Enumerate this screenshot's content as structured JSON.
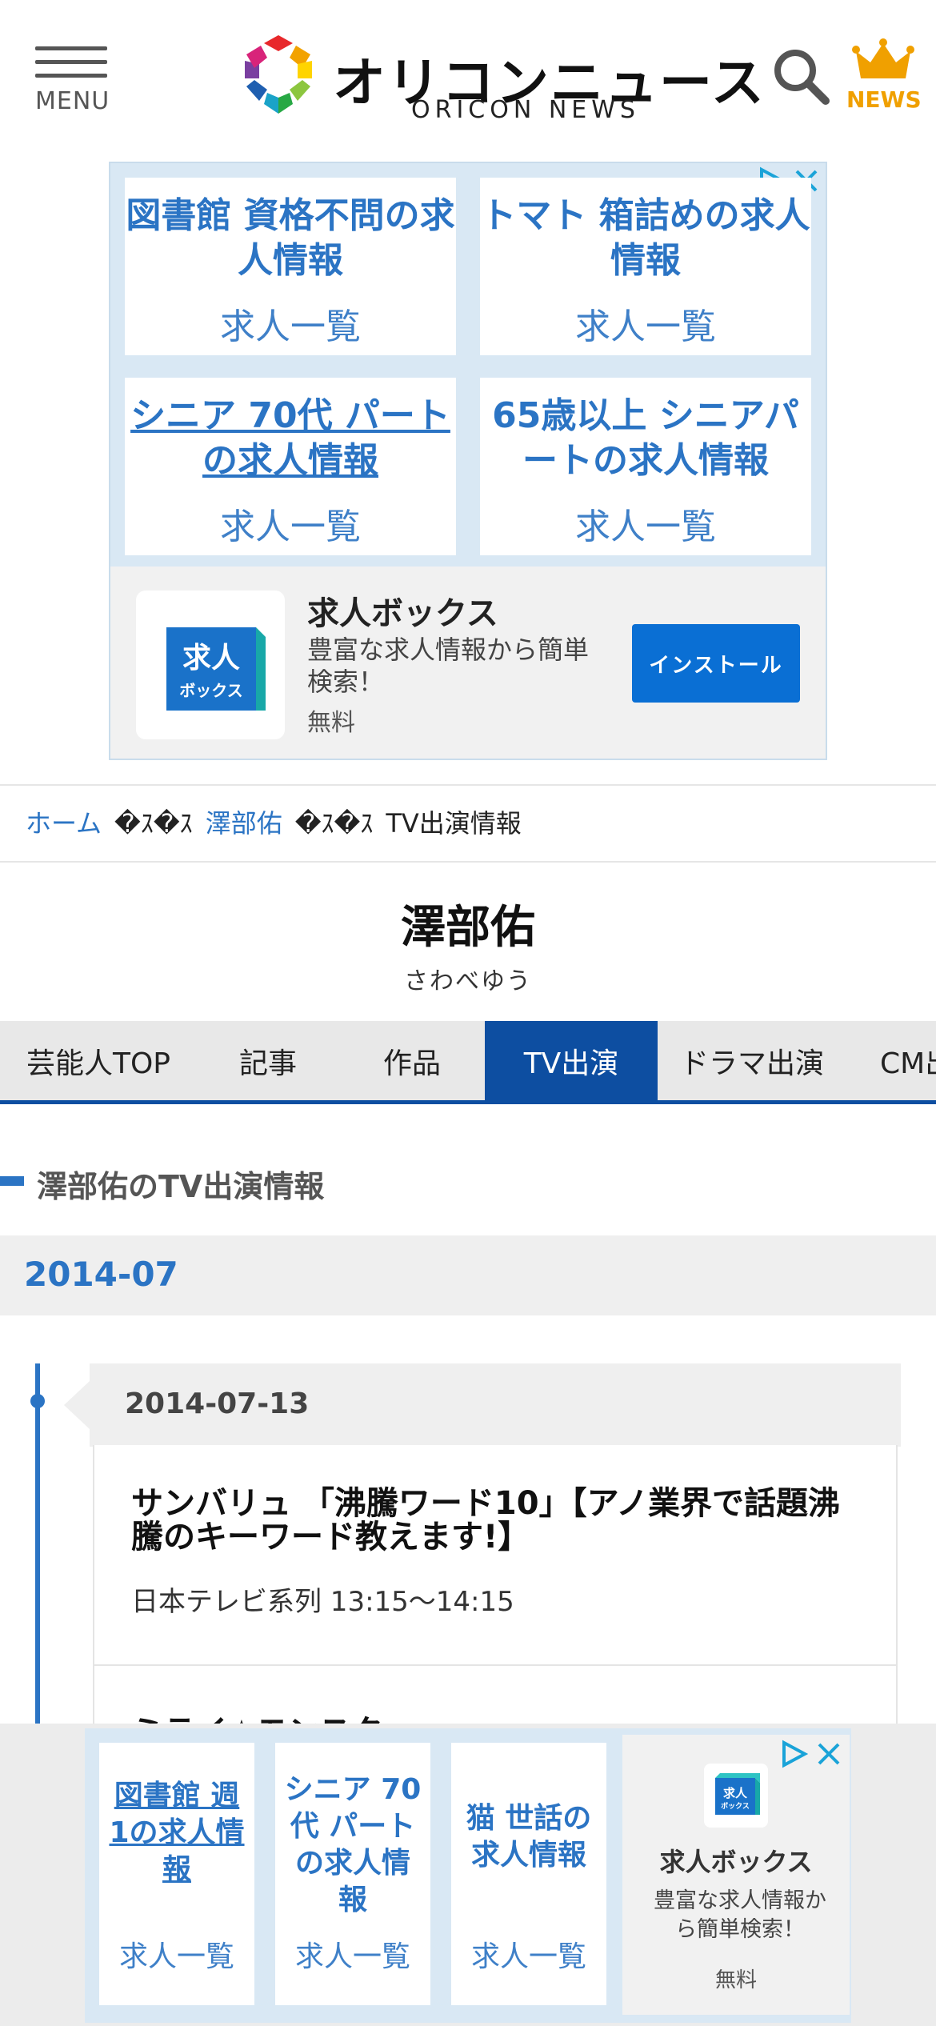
{
  "header": {
    "menu_label": "MENU",
    "logo_jp": "オリコンニュース",
    "logo_en": "ORICON NEWS",
    "news_label": "NEWS"
  },
  "ad_top": {
    "cells": [
      {
        "title": "図書館 資格不問の求人情報",
        "link": "求人一覧"
      },
      {
        "title": "トマト 箱詰めの求人情報",
        "link": "求人一覧"
      },
      {
        "title": "シニア 70代 パートの求人情報",
        "link": "求人一覧"
      },
      {
        "title": "65歳以上 シニアパートの求人情報",
        "link": "求人一覧"
      }
    ],
    "app": {
      "name": "求人ボックス",
      "description": "豊富な求人情報から簡単検索！",
      "price": "無料",
      "install_label": "インストール",
      "icon_text_1": "求人",
      "icon_text_2": "ボックス"
    }
  },
  "breadcrumb": {
    "home": "ホーム",
    "separator": "�ｽ�ｽ",
    "person": "澤部佑",
    "current": "TV出演情報"
  },
  "person": {
    "name": "澤部佑",
    "kana": "さわべゆう"
  },
  "tabs": [
    "芸能人TOP",
    "記事",
    "作品",
    "TV出演",
    "ドラマ出演",
    "CM出演"
  ],
  "active_tab": "TV出演",
  "section": {
    "title": "澤部佑のTV出演情報",
    "month": "2014-07",
    "date": "2014-07-13",
    "programs": [
      {
        "title": "サンバリュ 「沸騰ワード10」【アノ業界で話題沸騰のキーワード教えます!】",
        "meta": "日本テレビ系列 13:15〜14:15"
      },
      {
        "title": "ミライ☆モンスター",
        "meta": ""
      }
    ]
  },
  "ad_bottom": {
    "cells": [
      {
        "title": "図書館 週1の求人情報",
        "link": "求人一覧"
      },
      {
        "title": "シニア 70代 パートの求人情報",
        "link": "求人一覧"
      },
      {
        "title": "猫 世話の求人情報",
        "link": "求人一覧"
      }
    ],
    "app": {
      "name": "求人ボックス",
      "description": "豊富な求人情報から簡単検索！",
      "price": "無料"
    }
  },
  "colors": {
    "brand_blue": "#0d4ea1",
    "link_blue": "#2b74c4",
    "news_orange": "#f0a000"
  }
}
